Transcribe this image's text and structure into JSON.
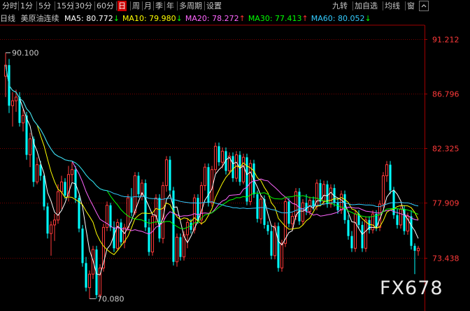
{
  "toolbar": {
    "tabs": [
      {
        "label": "分时",
        "active": false
      },
      {
        "label": "1分",
        "active": false
      },
      {
        "label": "5分",
        "active": false
      },
      {
        "label": "15分",
        "active": false
      },
      {
        "label": "30分",
        "active": false
      },
      {
        "label": "60分",
        "active": false
      },
      {
        "label": "日",
        "active": true
      },
      {
        "label": "周",
        "active": false
      },
      {
        "label": "月",
        "active": false
      },
      {
        "label": "季",
        "active": false
      },
      {
        "label": "年",
        "active": false
      },
      {
        "label": "多周期",
        "active": false
      },
      {
        "label": "设置",
        "active": false
      }
    ],
    "right_tabs": [
      "九转",
      "加自选",
      "均线",
      "窗"
    ],
    "collapse_icon": "chevron-up-icon"
  },
  "legend": {
    "period": "日线",
    "instrument": "美原油连续",
    "ma": [
      {
        "label": "MA5: 80.772",
        "arrow": "↓",
        "color": "#ffffff"
      },
      {
        "label": "MA10: 79.980",
        "arrow": "↓",
        "color": "#ffff00"
      },
      {
        "label": "MA20: 78.272",
        "arrow": "↑",
        "color": "#ff66ff"
      },
      {
        "label": "MA30: 77.413",
        "arrow": "↑",
        "color": "#00ff00"
      },
      {
        "label": "MA60: 80.052",
        "arrow": "↓",
        "color": "#33ccff"
      }
    ],
    "up_arrow_color": "#ff3030",
    "down_arrow_color": "#00ff00"
  },
  "chart_data": {
    "type": "candlestick",
    "ylim": [
      69.1,
      92.35
    ],
    "y_ticks": [
      "91.212",
      "86.796",
      "82.325",
      "77.909",
      "73.438"
    ],
    "annotations": {
      "high_label": "90.100",
      "low_label": "70.080"
    },
    "colors": {
      "up": "#ff3a3a",
      "down": "#00ffff",
      "axis_label": "#ff3a3a",
      "grid": "#7a0000"
    },
    "ohlc": [
      [
        88.2,
        90.1,
        86.5,
        89.1
      ],
      [
        89.1,
        89.6,
        85.2,
        85.8
      ],
      [
        85.8,
        86.9,
        84.1,
        86.2
      ],
      [
        86.2,
        87.1,
        85.3,
        86.5
      ],
      [
        86.5,
        86.9,
        84.1,
        84.4
      ],
      [
        84.4,
        85.5,
        83.7,
        85.0
      ],
      [
        85.0,
        85.3,
        81.4,
        81.8
      ],
      [
        81.8,
        83.6,
        80.8,
        83.1
      ],
      [
        83.1,
        83.3,
        79.2,
        79.6
      ],
      [
        79.6,
        81.6,
        79.4,
        81.0
      ],
      [
        81.0,
        81.3,
        79.7,
        80.1
      ],
      [
        80.1,
        80.3,
        77.3,
        77.6
      ],
      [
        77.6,
        77.9,
        75.0,
        75.4
      ],
      [
        75.4,
        76.4,
        73.6,
        76.1
      ],
      [
        76.1,
        77.0,
        74.8,
        76.5
      ],
      [
        76.5,
        79.4,
        76.2,
        78.8
      ],
      [
        78.8,
        80.1,
        77.4,
        79.6
      ],
      [
        79.6,
        79.9,
        78.2,
        78.5
      ],
      [
        78.5,
        80.9,
        78.0,
        80.2
      ],
      [
        80.2,
        81.2,
        79.6,
        80.6
      ],
      [
        80.6,
        80.9,
        77.9,
        78.3
      ],
      [
        78.3,
        78.5,
        75.5,
        75.8
      ],
      [
        75.8,
        76.1,
        72.7,
        73.0
      ],
      [
        73.0,
        73.5,
        70.7,
        71.0
      ],
      [
        71.0,
        72.4,
        70.1,
        72.1
      ],
      [
        72.1,
        74.4,
        71.7,
        74.1
      ],
      [
        74.1,
        74.4,
        70.1,
        70.4
      ],
      [
        70.4,
        72.9,
        70.1,
        72.6
      ],
      [
        72.6,
        76.2,
        72.3,
        75.9
      ],
      [
        75.9,
        78.0,
        75.6,
        77.7
      ],
      [
        77.7,
        77.9,
        75.6,
        75.9
      ],
      [
        75.9,
        76.4,
        73.9,
        74.2
      ],
      [
        74.2,
        76.6,
        74.0,
        76.3
      ],
      [
        76.3,
        76.6,
        74.4,
        74.7
      ],
      [
        74.7,
        76.2,
        74.2,
        75.9
      ],
      [
        75.9,
        78.6,
        75.6,
        78.3
      ],
      [
        78.3,
        79.1,
        76.8,
        77.1
      ],
      [
        77.1,
        80.4,
        76.9,
        80.1
      ],
      [
        80.1,
        80.4,
        78.3,
        78.6
      ],
      [
        78.6,
        79.8,
        78.1,
        79.5
      ],
      [
        79.5,
        79.8,
        75.6,
        75.9
      ],
      [
        75.9,
        76.6,
        73.6,
        73.9
      ],
      [
        73.9,
        77.1,
        73.6,
        76.8
      ],
      [
        76.8,
        78.6,
        76.1,
        78.3
      ],
      [
        78.3,
        78.6,
        74.7,
        75.0
      ],
      [
        75.0,
        79.6,
        74.6,
        79.3
      ],
      [
        79.3,
        81.7,
        78.8,
        81.4
      ],
      [
        81.4,
        81.7,
        78.6,
        78.9
      ],
      [
        78.9,
        79.2,
        72.8,
        73.1
      ],
      [
        73.1,
        75.4,
        72.7,
        75.1
      ],
      [
        75.1,
        75.4,
        73.2,
        73.5
      ],
      [
        73.5,
        75.6,
        73.2,
        75.3
      ],
      [
        75.3,
        76.6,
        74.2,
        76.3
      ],
      [
        76.3,
        76.6,
        75.4,
        75.7
      ],
      [
        75.7,
        78.6,
        75.4,
        78.3
      ],
      [
        78.3,
        78.6,
        76.2,
        76.5
      ],
      [
        76.5,
        79.6,
        76.1,
        79.3
      ],
      [
        79.3,
        81.1,
        78.9,
        80.8
      ],
      [
        80.8,
        81.1,
        77.6,
        77.9
      ],
      [
        77.9,
        80.9,
        77.6,
        80.6
      ],
      [
        80.6,
        82.8,
        80.3,
        82.5
      ],
      [
        82.5,
        82.8,
        80.9,
        81.2
      ],
      [
        81.2,
        82.4,
        80.7,
        82.1
      ],
      [
        82.1,
        82.4,
        80.2,
        80.5
      ],
      [
        80.5,
        82.0,
        80.2,
        81.7
      ],
      [
        81.7,
        82.0,
        79.6,
        79.9
      ],
      [
        79.9,
        82.1,
        79.6,
        81.8
      ],
      [
        81.8,
        82.1,
        79.3,
        79.6
      ],
      [
        79.6,
        81.9,
        79.4,
        81.6
      ],
      [
        81.6,
        81.9,
        77.7,
        78.0
      ],
      [
        78.0,
        81.4,
        77.7,
        81.1
      ],
      [
        81.1,
        81.4,
        78.3,
        78.6
      ],
      [
        78.6,
        78.9,
        76.3,
        76.6
      ],
      [
        76.6,
        78.5,
        76.2,
        78.2
      ],
      [
        78.2,
        78.5,
        75.8,
        76.1
      ],
      [
        76.1,
        76.4,
        75.3,
        75.6
      ],
      [
        75.6,
        76.1,
        73.3,
        73.6
      ],
      [
        73.6,
        76.3,
        73.3,
        76.0
      ],
      [
        76.0,
        76.3,
        72.3,
        72.6
      ],
      [
        72.6,
        74.9,
        72.3,
        74.6
      ],
      [
        74.6,
        78.3,
        74.3,
        78.0
      ],
      [
        78.0,
        78.3,
        75.9,
        76.2
      ],
      [
        76.2,
        77.1,
        75.6,
        76.8
      ],
      [
        76.8,
        79.1,
        76.5,
        78.8
      ],
      [
        78.8,
        79.1,
        76.1,
        76.4
      ],
      [
        76.4,
        78.2,
        76.1,
        77.9
      ],
      [
        77.9,
        78.6,
        76.9,
        77.2
      ],
      [
        77.2,
        78.4,
        76.9,
        78.1
      ],
      [
        78.1,
        78.4,
        77.3,
        77.6
      ],
      [
        77.6,
        79.8,
        77.3,
        79.5
      ],
      [
        79.5,
        79.8,
        77.7,
        78.0
      ],
      [
        78.0,
        79.7,
        77.7,
        79.4
      ],
      [
        79.4,
        79.7,
        77.5,
        77.8
      ],
      [
        77.8,
        79.4,
        77.5,
        79.1
      ],
      [
        79.1,
        79.4,
        77.6,
        77.9
      ],
      [
        77.9,
        78.3,
        77.0,
        77.3
      ],
      [
        77.3,
        78.9,
        77.0,
        78.6
      ],
      [
        78.6,
        78.9,
        76.2,
        76.5
      ],
      [
        76.5,
        76.9,
        74.9,
        75.2
      ],
      [
        75.2,
        75.6,
        73.9,
        74.2
      ],
      [
        74.2,
        77.3,
        73.9,
        77.0
      ],
      [
        77.0,
        77.3,
        75.8,
        76.1
      ],
      [
        76.1,
        76.4,
        73.9,
        74.2
      ],
      [
        74.2,
        76.8,
        73.9,
        76.5
      ],
      [
        76.5,
        76.8,
        75.4,
        75.7
      ],
      [
        75.7,
        77.3,
        75.4,
        77.0
      ],
      [
        77.0,
        77.3,
        75.6,
        75.9
      ],
      [
        75.9,
        78.1,
        75.6,
        77.8
      ],
      [
        77.8,
        80.4,
        77.5,
        80.1
      ],
      [
        80.1,
        81.3,
        79.6,
        81.0
      ],
      [
        81.0,
        81.3,
        78.6,
        78.9
      ],
      [
        78.9,
        79.2,
        76.6,
        76.9
      ],
      [
        76.9,
        77.4,
        75.8,
        76.1
      ],
      [
        76.1,
        77.7,
        75.8,
        77.4
      ],
      [
        77.4,
        77.7,
        75.3,
        75.6
      ],
      [
        75.6,
        77.1,
        75.3,
        76.8
      ],
      [
        76.8,
        77.3,
        74.1,
        74.4
      ],
      [
        74.4,
        74.6,
        72.1,
        74.0
      ],
      [
        74.0,
        74.4,
        73.6,
        74.2
      ]
    ]
  },
  "watermark": "FX678"
}
